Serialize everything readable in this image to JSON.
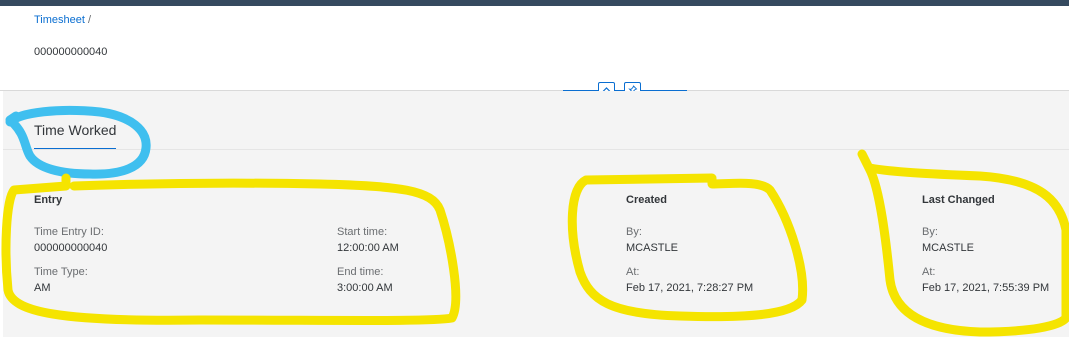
{
  "breadcrumb": {
    "link": "Timesheet",
    "separator": "/"
  },
  "object_title": "000000000040",
  "section": {
    "title": "Time Worked"
  },
  "entry": {
    "title": "Entry",
    "time_entry_id_label": "Time Entry ID:",
    "time_entry_id_value": "000000000040",
    "time_type_label": "Time Type:",
    "time_type_value": "AM",
    "start_time_label": "Start time:",
    "start_time_value": "12:00:00 AM",
    "end_time_label": "End time:",
    "end_time_value": "3:00:00 AM"
  },
  "created": {
    "title": "Created",
    "by_label": "By:",
    "by_value": "MCASTLE",
    "at_label": "At:",
    "at_value": "Feb 17, 2021, 7:28:27 PM"
  },
  "last_changed": {
    "title": "Last Changed",
    "by_label": "By:",
    "by_value": "MCASTLE",
    "at_label": "At:",
    "at_value": "Feb 17, 2021, 7:55:39 PM"
  },
  "icons": {
    "collapse": "chevron-up-icon",
    "pin": "pin-icon"
  },
  "colors": {
    "shell_bar": "#354a5f",
    "link": "#0a6ed1",
    "content_bg": "#f4f4f4",
    "highlight_yellow": "#f5e400",
    "highlight_blue": "#3fbfef"
  }
}
